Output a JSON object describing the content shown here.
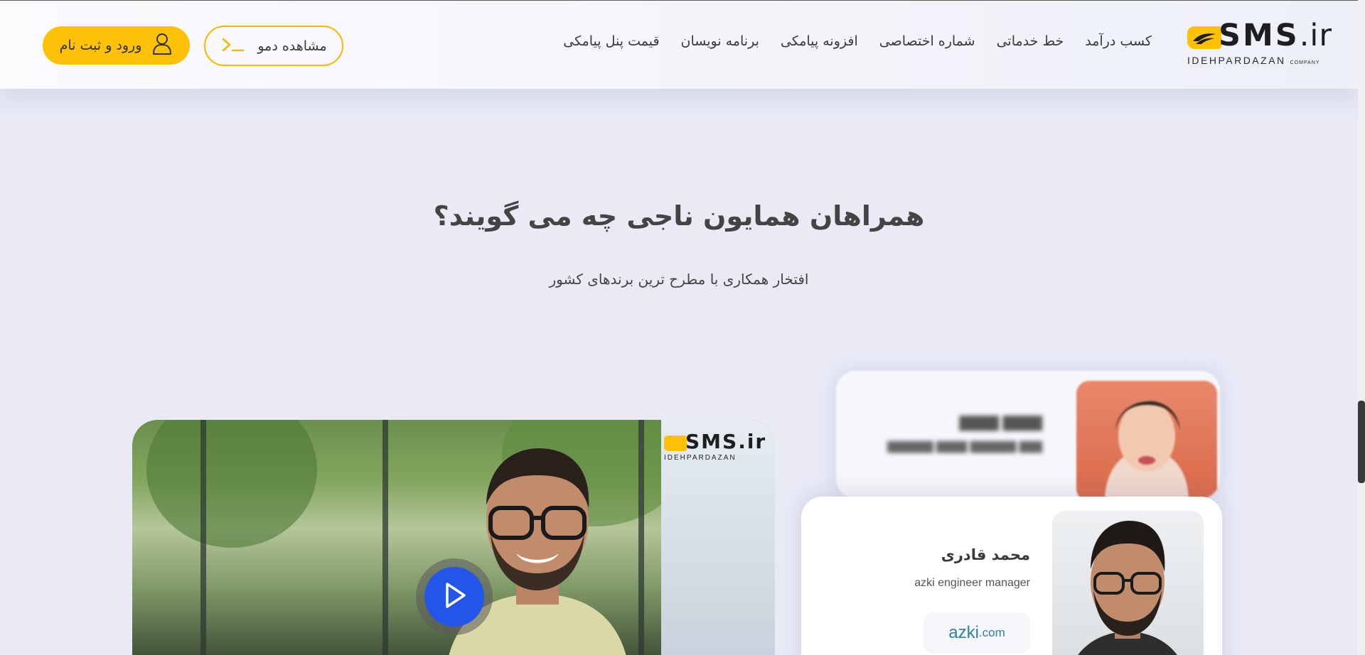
{
  "header": {
    "logo_text": "SMS",
    "logo_tld": ".ir",
    "logo_sub": "IDEHPARDAZAN",
    "logo_sub_small": "COMPANY",
    "nav": [
      {
        "id": "pricing",
        "label": "قیمت پنل پیامکی"
      },
      {
        "id": "developers",
        "label": "برنامه نویسان"
      },
      {
        "id": "addon",
        "label": "افزونه پیامکی"
      },
      {
        "id": "dedicated-number",
        "label": "شماره اختصاصی"
      },
      {
        "id": "service-line",
        "label": "خط خدماتی"
      },
      {
        "id": "earn",
        "label": "کسب درآمد"
      }
    ],
    "demo_button": "مشاهده دمو",
    "login_button": "ورود و ثبت نام"
  },
  "section": {
    "title": "همراهان همایون ناجی چه می گویند؟",
    "subtitle": "افتخار همکاری با مطرح ترین برندهای کشور"
  },
  "video": {
    "logo_text": "SMS.ir",
    "logo_sub": "IDEHPARDAZAN"
  },
  "testimonial": {
    "name": "محمد قادری",
    "role": "azki engineer manager",
    "brand_main": "azki",
    "brand_tld": ".com"
  },
  "colors": {
    "accent": "#ffc107",
    "play": "#2356e8",
    "background": "#e9eaf6"
  }
}
